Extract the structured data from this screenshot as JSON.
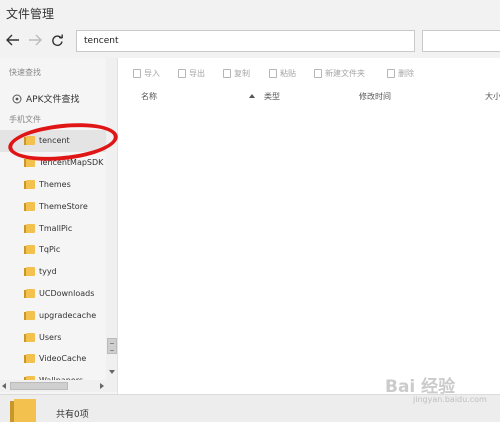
{
  "window": {
    "title": "文件管理"
  },
  "nav": {
    "path_value": "tencent",
    "search_value": ""
  },
  "sidebar": {
    "quick_label": "快速查找",
    "apk_label": "APK文件查找",
    "phone_label": "手机文件",
    "folders": [
      {
        "label": "tencent"
      },
      {
        "label": "TencentMapSDK"
      },
      {
        "label": "Themes"
      },
      {
        "label": "ThemeStore"
      },
      {
        "label": "TmallPic"
      },
      {
        "label": "TqPic"
      },
      {
        "label": "tyyd"
      },
      {
        "label": "UCDownloads"
      },
      {
        "label": "upgradecache"
      },
      {
        "label": "Users"
      },
      {
        "label": "VideoCache"
      },
      {
        "label": "Wallpapers"
      }
    ]
  },
  "toolbar": {
    "import": "导入",
    "export": "导出",
    "copy": "复制",
    "paste": "粘贴",
    "new_folder": "新建文件夹",
    "delete": "删除"
  },
  "columns": {
    "name": "名称",
    "type": "类型",
    "modified": "修改时间",
    "size": "大小"
  },
  "status": {
    "count_text": "共有0项"
  },
  "watermark": {
    "brand": "Bai 经验",
    "sub": "jingyan.baidu.com"
  }
}
